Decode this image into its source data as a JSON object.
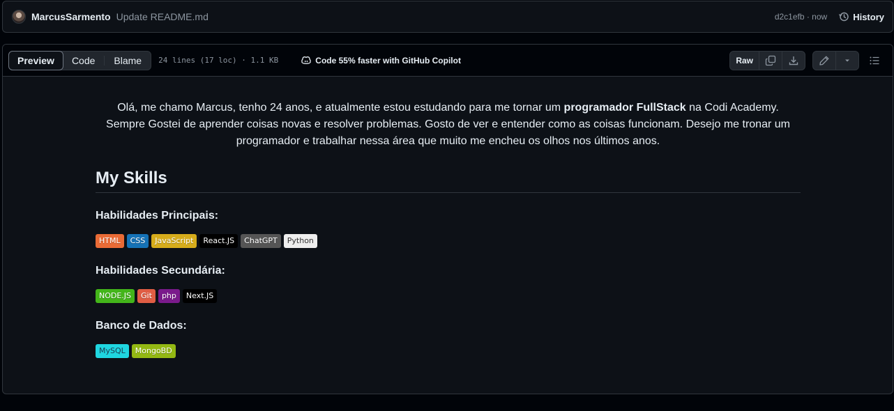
{
  "commit": {
    "author": "MarcusSarmento",
    "message": "Update README.md",
    "meta": "d2c1efb · now",
    "history_label": "History"
  },
  "file_header": {
    "tabs": [
      {
        "label": "Preview",
        "active": true
      },
      {
        "label": "Code",
        "active": false
      },
      {
        "label": "Blame",
        "active": false
      }
    ],
    "info": "24 lines (17 loc) · 1.1 KB",
    "copilot_label": "Code 55% faster with GitHub Copilot",
    "raw_label": "Raw",
    "icons": [
      "copy-icon",
      "download-icon",
      "pencil-icon",
      "triangle-down-icon",
      "list-icon"
    ]
  },
  "readme": {
    "intro_1": "Olá, me chamo Marcus, tenho 24 anos, e atualmente estou estudando para me tornar um ",
    "intro_bold": "programador FullStack",
    "intro_2": " na Codi Academy. Sempre Gostei de aprender coisas novas e resolver problemas. Gosto de ver e entender como as coisas funcionam. Desejo me tronar um programador e trabalhar nessa área que muito me encheu os olhos nos últimos anos.",
    "skills_title": "My Skills",
    "sections": [
      {
        "title": "Habilidades Principais:",
        "badges": [
          {
            "label": "HTML",
            "color": "#e96b36",
            "text": "#ffffff"
          },
          {
            "label": "CSS",
            "color": "#1572b6",
            "text": "#ffffff"
          },
          {
            "label": "JavaScript",
            "color": "#d6ac1b",
            "text": "#ffffff"
          },
          {
            "label": "React.JS",
            "color": "#000000",
            "text": "#ffffff"
          },
          {
            "label": "ChatGPT",
            "color": "#555555",
            "text": "#ffffff"
          },
          {
            "label": "Python",
            "color": "#eeeeee",
            "text": "#333333"
          }
        ]
      },
      {
        "title": "Habilidades Secundária:",
        "badges": [
          {
            "label": "NODE.JS",
            "color": "#43b51a",
            "text": "#ffffff"
          },
          {
            "label": "Git",
            "color": "#e05d44",
            "text": "#ffffff"
          },
          {
            "label": "php",
            "color": "#7a1a8b",
            "text": "#ffffff"
          },
          {
            "label": "Next.JS",
            "color": "#000000",
            "text": "#ffffff"
          }
        ]
      },
      {
        "title": "Banco de Dados:",
        "badges": [
          {
            "label": "MySQL",
            "color": "#1fd6e0",
            "text": "#1a3c50"
          },
          {
            "label": "MongoBD",
            "color": "#93b813",
            "text": "#ffffff"
          }
        ]
      }
    ]
  }
}
